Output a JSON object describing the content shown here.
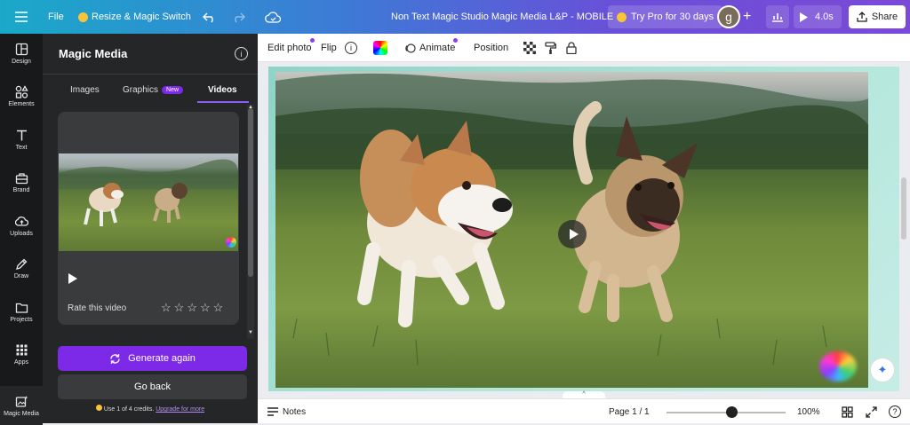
{
  "topbar": {
    "file_label": "File",
    "resize_label": "Resize & Magic Switch",
    "doc_title": "Non Text Magic Studio Magic Media L&P - MOBILE",
    "trypro_label": "Try Pro for 30 days",
    "avatar_letter": "g",
    "present_label": "4.0s",
    "share_label": "Share"
  },
  "rail": [
    {
      "label": "Design",
      "icon": "design-icon"
    },
    {
      "label": "Elements",
      "icon": "elements-icon"
    },
    {
      "label": "Text",
      "icon": "text-icon"
    },
    {
      "label": "Brand",
      "icon": "brand-icon"
    },
    {
      "label": "Uploads",
      "icon": "uploads-icon"
    },
    {
      "label": "Draw",
      "icon": "draw-icon"
    },
    {
      "label": "Projects",
      "icon": "projects-icon"
    },
    {
      "label": "Apps",
      "icon": "apps-icon"
    },
    {
      "label": "Magic Media",
      "icon": "magic-media-icon"
    }
  ],
  "panel": {
    "title": "Magic Media",
    "tabs": [
      "Images",
      "Graphics",
      "Videos"
    ],
    "new_badge": "New",
    "active_tab": "Videos",
    "rate_label": "Rate this video",
    "rating": 0,
    "generate_label": "Generate again",
    "back_label": "Go back",
    "credits_text": "Use 1 of 4 credits.",
    "upgrade_text": "Upgrade for more"
  },
  "context_toolbar": {
    "edit_photo": "Edit photo",
    "flip": "Flip",
    "animate": "Animate",
    "position": "Position"
  },
  "bottombar": {
    "notes_label": "Notes",
    "page_label": "Page 1 / 1",
    "zoom_label": "100%",
    "zoom_fraction": 0.55
  },
  "colors": {
    "accent": "#7d2ae8",
    "panel_bg": "#252627",
    "rail_bg": "#18191b"
  }
}
